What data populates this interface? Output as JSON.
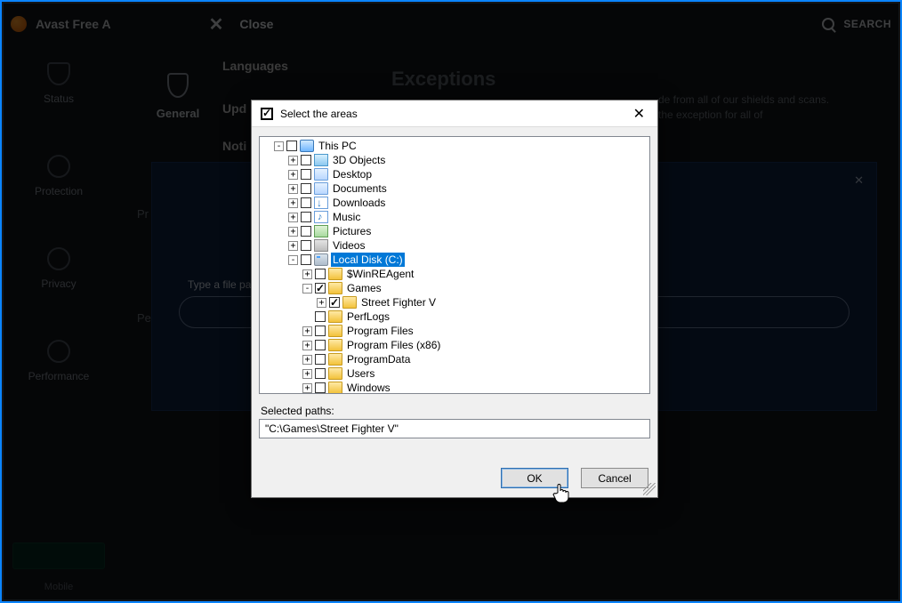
{
  "app_title": "Avast Free A",
  "close_label": "Close",
  "search_label": "SEARCH",
  "leftrail": {
    "status": "Status",
    "protection": "Protection",
    "privacy": "Privacy",
    "performance": "Performance",
    "mobile": "Mobile"
  },
  "secondary": {
    "general": "General",
    "items": {
      "languages": "Languages",
      "update": "Upd",
      "notifications": "Noti",
      "p1": "Pr",
      "p2": "Per"
    }
  },
  "page": {
    "title": "Exceptions",
    "desc_l1": "de from all of our shields and scans.",
    "desc_l2": "the exception for all of"
  },
  "panel": {
    "label": "Type a file pa"
  },
  "dialog": {
    "title": "Select the areas",
    "selected_label": "Selected paths:",
    "selected_value": "\"C:\\Games\\Street Fighter V\"",
    "ok": "OK",
    "cancel": "Cancel",
    "tree": {
      "root": "This PC",
      "objects3d": "3D Objects",
      "desktop": "Desktop",
      "documents": "Documents",
      "downloads": "Downloads",
      "music": "Music",
      "pictures": "Pictures",
      "videos": "Videos",
      "cdrive": "Local Disk (C:)",
      "winre": "$WinREAgent",
      "games": "Games",
      "sfv": "Street Fighter V",
      "perflogs": "PerfLogs",
      "progfiles": "Program Files",
      "progfiles86": "Program Files (x86)",
      "progdata": "ProgramData",
      "users": "Users",
      "windows": "Windows"
    }
  }
}
